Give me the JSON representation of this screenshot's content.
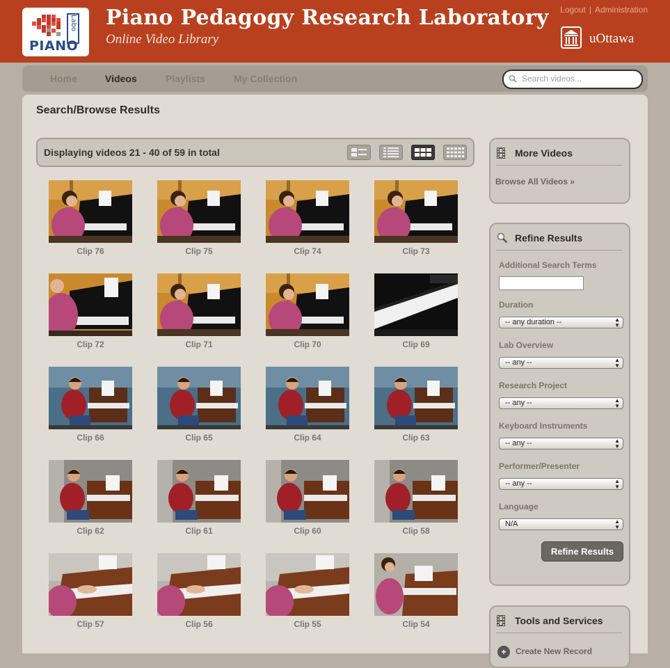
{
  "header": {
    "logo_text": "PIANO",
    "logo_labo": "Labo",
    "title": "Piano Pedagogy Research Laboratory",
    "subtitle": "Online Video Library",
    "links": {
      "logout": "Logout",
      "separator": "|",
      "admin": "Administration"
    },
    "university": "uOttawa"
  },
  "nav": {
    "items": [
      {
        "label": "Home",
        "active": false
      },
      {
        "label": "Videos",
        "active": true
      },
      {
        "label": "Playlists",
        "active": false
      },
      {
        "label": "My Collection",
        "active": false
      }
    ],
    "search_placeholder": "Search videos..."
  },
  "main": {
    "heading": "Search/Browse Results",
    "results_text": "Displaying videos 21 - 40 of 59 in total",
    "view_modes": [
      "detail-list",
      "compact-list",
      "grid",
      "small-grid"
    ],
    "active_view": "grid",
    "clips": [
      {
        "label": "Clip 76",
        "scene": "woman-bg"
      },
      {
        "label": "Clip 75",
        "scene": "woman-bg"
      },
      {
        "label": "Clip 74",
        "scene": "woman-bg"
      },
      {
        "label": "Clip 73",
        "scene": "woman-bg"
      },
      {
        "label": "Clip 72",
        "scene": "woman-close"
      },
      {
        "label": "Clip 71",
        "scene": "woman-bg"
      },
      {
        "label": "Clip 70",
        "scene": "woman-bg"
      },
      {
        "label": "Clip 69",
        "scene": "keyboard-dark"
      },
      {
        "label": "Clip 66",
        "scene": "man-blue"
      },
      {
        "label": "Clip 65",
        "scene": "man-blue"
      },
      {
        "label": "Clip 64",
        "scene": "man-blue"
      },
      {
        "label": "Clip 63",
        "scene": "man-blue"
      },
      {
        "label": "Clip 62",
        "scene": "man-wood"
      },
      {
        "label": "Clip 61",
        "scene": "man-wood"
      },
      {
        "label": "Clip 60",
        "scene": "man-wood"
      },
      {
        "label": "Clip 58",
        "scene": "man-wood"
      },
      {
        "label": "Clip 57",
        "scene": "hands-wood"
      },
      {
        "label": "Clip 56",
        "scene": "hands-wood"
      },
      {
        "label": "Clip 55",
        "scene": "hands-wood"
      },
      {
        "label": "Clip 54",
        "scene": "woman-wood"
      }
    ]
  },
  "sidebar": {
    "more_videos": {
      "title": "More Videos",
      "link": "Browse All Videos »"
    },
    "refine": {
      "title": "Refine Results",
      "search_label": "Additional Search Terms",
      "search_value": "",
      "filters": [
        {
          "label": "Duration",
          "value": "-- any duration --"
        },
        {
          "label": "Lab Overview",
          "value": "-- any --"
        },
        {
          "label": "Research Project",
          "value": "-- any --"
        },
        {
          "label": "Keyboard Instruments",
          "value": "-- any --"
        },
        {
          "label": "Performer/Presenter",
          "value": "-- any --"
        },
        {
          "label": "Language",
          "value": "N/A"
        }
      ],
      "button": "Refine Results"
    },
    "tools": {
      "title": "Tools and Services",
      "item": "Create New Record"
    }
  },
  "colors": {
    "header_bg": "#b9401e",
    "page_bg": "#b8b0a4",
    "content_bg": "#e0dcd3",
    "nav_bg": "#a59d91"
  }
}
